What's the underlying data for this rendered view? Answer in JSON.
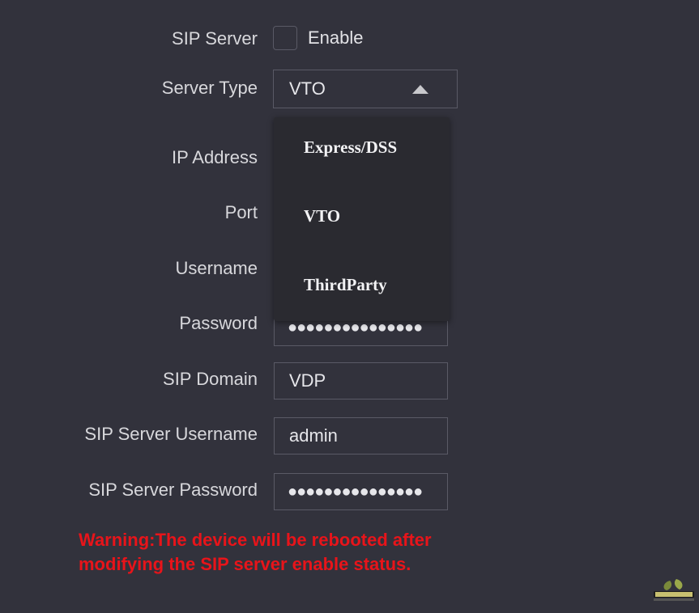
{
  "form": {
    "sip_server_label": "SIP Server",
    "enable_label": "Enable",
    "enable_checked": false,
    "server_type_label": "Server Type",
    "server_type_value": "VTO",
    "ip_address_label": "IP Address",
    "port_label": "Port",
    "username_label": "Username",
    "password_label": "Password",
    "password_value": "●●●●●●●●●●●●●●●",
    "sip_domain_label": "SIP Domain",
    "sip_domain_value": "VDP",
    "sip_server_username_label": "SIP Server Username",
    "sip_server_username_value": "admin",
    "sip_server_password_label": "SIP Server Password",
    "sip_server_password_value": "●●●●●●●●●●●●●●●"
  },
  "dropdown": {
    "options": [
      "Express/DSS",
      "VTO",
      "ThirdParty"
    ]
  },
  "warning": {
    "text": "Warning:The device will be rebooted after modifying the SIP server enable status."
  },
  "icons": {
    "caret": "caret-up-icon",
    "logo": "watermark-logo"
  },
  "colors": {
    "background": "#32323c",
    "field_border": "#5a5a66",
    "dropdown_bg": "#2a2a30",
    "warning": "#e8141a"
  }
}
